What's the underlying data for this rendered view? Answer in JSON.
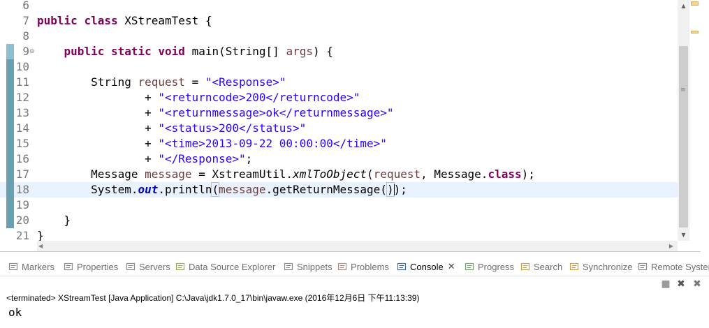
{
  "editor": {
    "lines": [
      {
        "num": "6",
        "segs": []
      },
      {
        "num": "7",
        "segs": [
          [
            "kw",
            "public"
          ],
          [
            "t",
            " "
          ],
          [
            "kw",
            "class"
          ],
          [
            "t",
            " XStreamTest {"
          ]
        ]
      },
      {
        "num": "8",
        "segs": []
      },
      {
        "num": "9",
        "fold": "⊖",
        "segs": [
          [
            "t",
            "    "
          ],
          [
            "kw",
            "public"
          ],
          [
            "t",
            " "
          ],
          [
            "kw",
            "static"
          ],
          [
            "t",
            " "
          ],
          [
            "kw",
            "void"
          ],
          [
            "t",
            " main(String[] "
          ],
          [
            "var",
            "args"
          ],
          [
            "t",
            ") {"
          ]
        ]
      },
      {
        "num": "10",
        "segs": []
      },
      {
        "num": "11",
        "segs": [
          [
            "t",
            "        String "
          ],
          [
            "var",
            "request"
          ],
          [
            "t",
            " = "
          ],
          [
            "str",
            "\"<Response>\""
          ]
        ]
      },
      {
        "num": "12",
        "segs": [
          [
            "t",
            "                + "
          ],
          [
            "str",
            "\"<returncode>200</returncode>\""
          ]
        ]
      },
      {
        "num": "13",
        "segs": [
          [
            "t",
            "                + "
          ],
          [
            "str",
            "\"<returnmessage>ok</returnmessage>\""
          ]
        ]
      },
      {
        "num": "14",
        "segs": [
          [
            "t",
            "                + "
          ],
          [
            "str",
            "\"<status>200</status>\""
          ]
        ]
      },
      {
        "num": "15",
        "segs": [
          [
            "t",
            "                + "
          ],
          [
            "str",
            "\"<time>2013-09-22 00:00:00</time>\""
          ]
        ]
      },
      {
        "num": "16",
        "segs": [
          [
            "t",
            "                + "
          ],
          [
            "str",
            "\"</Response>\""
          ],
          [
            "t",
            ";"
          ]
        ]
      },
      {
        "num": "17",
        "segs": [
          [
            "t",
            "        Message "
          ],
          [
            "var",
            "message"
          ],
          [
            "t",
            " = XstreamUtil."
          ],
          [
            "mth",
            "xmlToObject"
          ],
          [
            "t",
            "("
          ],
          [
            "var",
            "request"
          ],
          [
            "t",
            ", Message."
          ],
          [
            "kw",
            "class"
          ],
          [
            "t",
            ");"
          ]
        ]
      },
      {
        "num": "18",
        "current": true,
        "segs": [
          [
            "t",
            "        System."
          ],
          [
            "fld",
            "out"
          ],
          [
            "t",
            ".println"
          ],
          [
            "box",
            "("
          ],
          [
            "var",
            "message"
          ],
          [
            "t",
            ".getReturnMessage("
          ],
          [
            "box",
            ")"
          ],
          [
            "t",
            ")"
          ],
          [
            "t",
            ";"
          ]
        ]
      },
      {
        "num": "19",
        "segs": []
      },
      {
        "num": "20",
        "segs": [
          [
            "t",
            "    }"
          ]
        ]
      },
      {
        "num": "21",
        "segs": [
          [
            "t",
            "}"
          ]
        ]
      }
    ]
  },
  "views": {
    "tabs": [
      {
        "label": "Markers",
        "icon": "markers-icon"
      },
      {
        "label": "Properties",
        "icon": "properties-icon"
      },
      {
        "label": "Servers",
        "icon": "servers-icon"
      },
      {
        "label": "Data Source Explorer",
        "icon": "data-source-explorer-icon"
      },
      {
        "label": "Snippets",
        "icon": "snippets-icon"
      },
      {
        "label": "Problems",
        "icon": "problems-icon"
      },
      {
        "label": "Console",
        "icon": "console-icon",
        "active": true
      },
      {
        "label": "Progress",
        "icon": "progress-icon"
      },
      {
        "label": "Search",
        "icon": "search-icon"
      },
      {
        "label": "Synchronize",
        "icon": "synchronize-icon"
      },
      {
        "label": "Remote Systems",
        "icon": "remote-systems-icon"
      }
    ],
    "close_symbol": "✕"
  },
  "console": {
    "status": "<terminated> XStreamTest [Java Application] C:\\Java\\jdk1.7.0_17\\bin\\javaw.exe (2016年12月6日 下午11:13:39)",
    "output": "ok"
  },
  "colors": {
    "keyword": "#7f0055",
    "string": "#2a00ff",
    "variable": "#6a3e3e",
    "static_field": "#0000c0",
    "current_line": "#e8f2fe",
    "change_bar": "#6a9fb0"
  }
}
